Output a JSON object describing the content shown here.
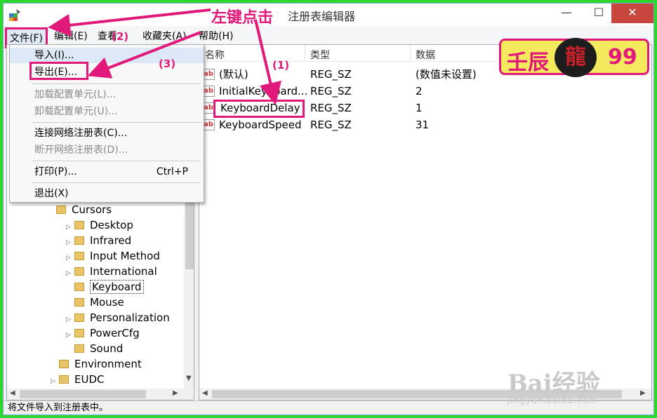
{
  "window": {
    "title": "注册表编辑器",
    "annotation": "左键点击"
  },
  "menubar": {
    "items": [
      "文件(F)",
      "编辑(E)",
      "查看",
      "收藏夹(A)",
      "帮助(H)"
    ],
    "annotation_2": "(2)",
    "annotation_3": "(3)"
  },
  "file_menu": {
    "import": "导入(I)...",
    "export": "导出(E)...",
    "load_hive": "加载配置单元(L)...",
    "unload_hive": "卸载配置单元(U)...",
    "connect_network": "连接网络注册表(C)...",
    "disconnect_network": "断开网络注册表(D)...",
    "print": "打印(P)...",
    "print_shortcut": "Ctrl+P",
    "exit": "退出(X)"
  },
  "tree": {
    "items": [
      "Cursors",
      "Desktop",
      "Infrared",
      "Input Method",
      "International",
      "Keyboard",
      "Mouse",
      "Personalization",
      "PowerCfg",
      "Sound",
      "Environment",
      "EUDC"
    ],
    "selected": "Keyboard"
  },
  "list": {
    "headers": [
      "名称",
      "类型",
      "数据"
    ],
    "rows": [
      {
        "name": "(默认)",
        "type": "REG_SZ",
        "data": "(数值未设置)"
      },
      {
        "name": "InitialKeyboard...",
        "type": "REG_SZ",
        "data": "2"
      },
      {
        "name": "KeyboardDelay",
        "type": "REG_SZ",
        "data": "1"
      },
      {
        "name": "KeyboardSpeed",
        "type": "REG_SZ",
        "data": "31"
      }
    ],
    "annotation_1": "(1)"
  },
  "statusbar": {
    "text": "将文件导入到注册表中。"
  },
  "logo": {
    "text": "壬辰",
    "char": "龍",
    "number": "99"
  },
  "watermark": {
    "brand": "Bai经验",
    "url": "jingyan.baidu.com"
  },
  "colors": {
    "annotation": "#e0197a",
    "frame": "#2bd82b",
    "close_button": "#c7463e"
  }
}
